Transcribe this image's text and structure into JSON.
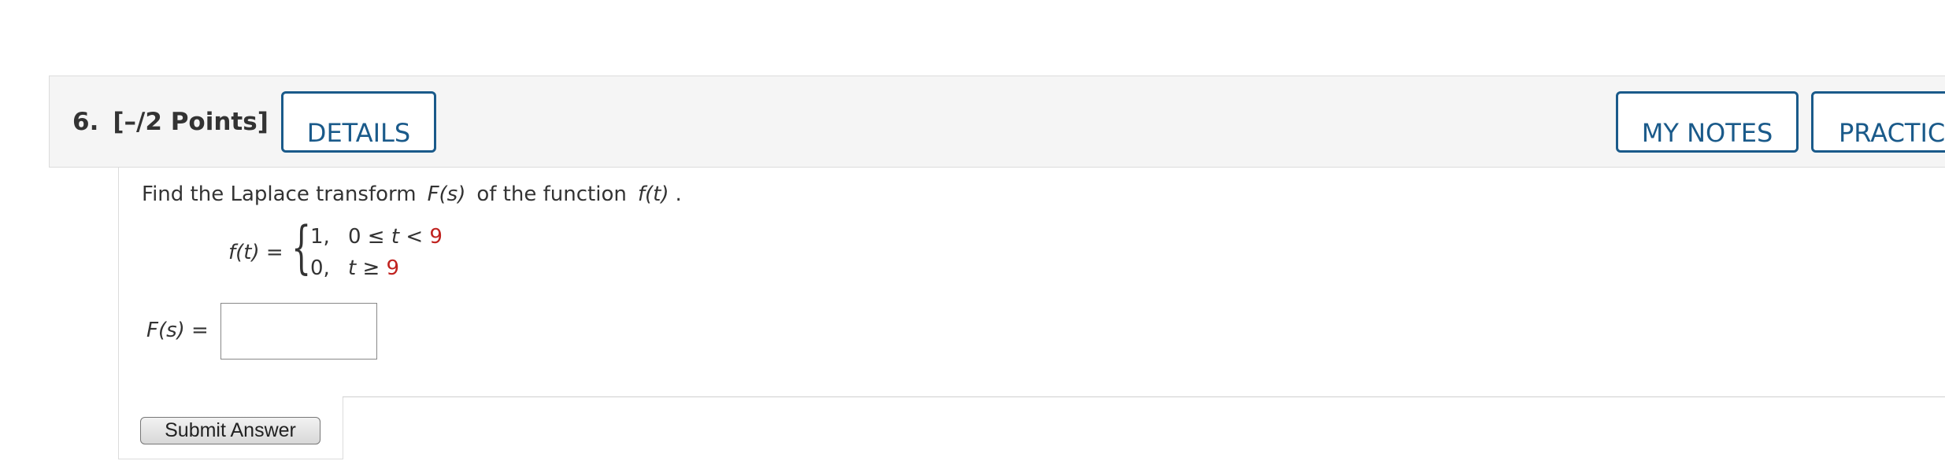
{
  "question": {
    "number": "6.",
    "points": "[–/2 Points]"
  },
  "header_buttons": {
    "details": "DETAILS",
    "my_notes": "MY NOTES",
    "practice": "PRACTICE"
  },
  "prompt": {
    "text_1": "Find the Laplace transform",
    "math_F": "F(s)",
    "text_2": "of the function",
    "math_f": "f(t)",
    "text_3": "."
  },
  "piecewise": {
    "lhs": "f(t) =",
    "rows": [
      {
        "value": "1,",
        "cond_prefix": "0 ≤ ",
        "var": "t",
        "cond_op": " < ",
        "bound": "9"
      },
      {
        "value": "0,",
        "cond_prefix": "",
        "var": "t",
        "cond_op": " ≥ ",
        "bound": "9"
      }
    ]
  },
  "answer": {
    "label": "F(s) =",
    "value": ""
  },
  "submit": {
    "label": "Submit Answer"
  },
  "colors": {
    "accent": "#1a5a8a",
    "highlight": "#c0221f",
    "header_bg": "#f5f5f5"
  }
}
